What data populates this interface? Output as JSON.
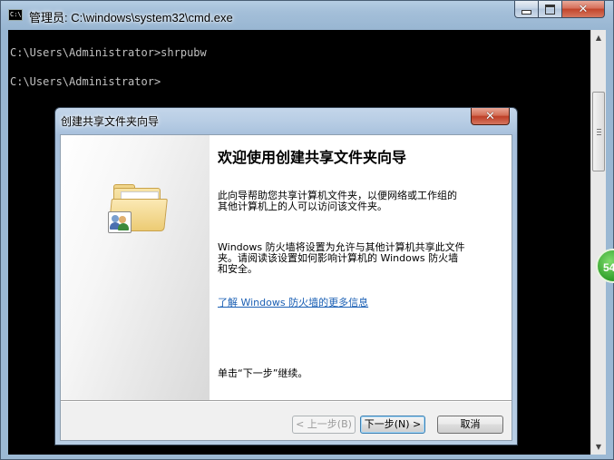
{
  "cmd_window": {
    "title": "管理员: C:\\windows\\system32\\cmd.exe",
    "icon": "cmd-app-icon",
    "icon_text": "C:\\",
    "lines": [
      "C:\\Users\\Administrator>shrpubw",
      "",
      "C:\\Users\\Administrator>"
    ]
  },
  "badge": {
    "text": "54"
  },
  "wizard": {
    "title": "创建共享文件夹向导",
    "heading": "欢迎使用创建共享文件夹向导",
    "para1_line1": "此向导帮助您共享计算机文件夹，以便网络或工作组的",
    "para1_line2": "其他计算机上的人可以访问该文件夹。",
    "para2_line1": "Windows 防火墙将设置为允许与其他计算机共享此文件",
    "para2_line2": "夹。请阅读该设置如何影响计算机的 Windows 防火墙",
    "para2_line3": "和安全。",
    "link": "了解 Windows 防火墙的更多信息",
    "continue_text": "单击“下一步”继续。",
    "buttons": {
      "back": "< 上一步(B)",
      "next": "下一步(N) >",
      "cancel": "取消"
    },
    "icon": "shared-folder-icon"
  }
}
